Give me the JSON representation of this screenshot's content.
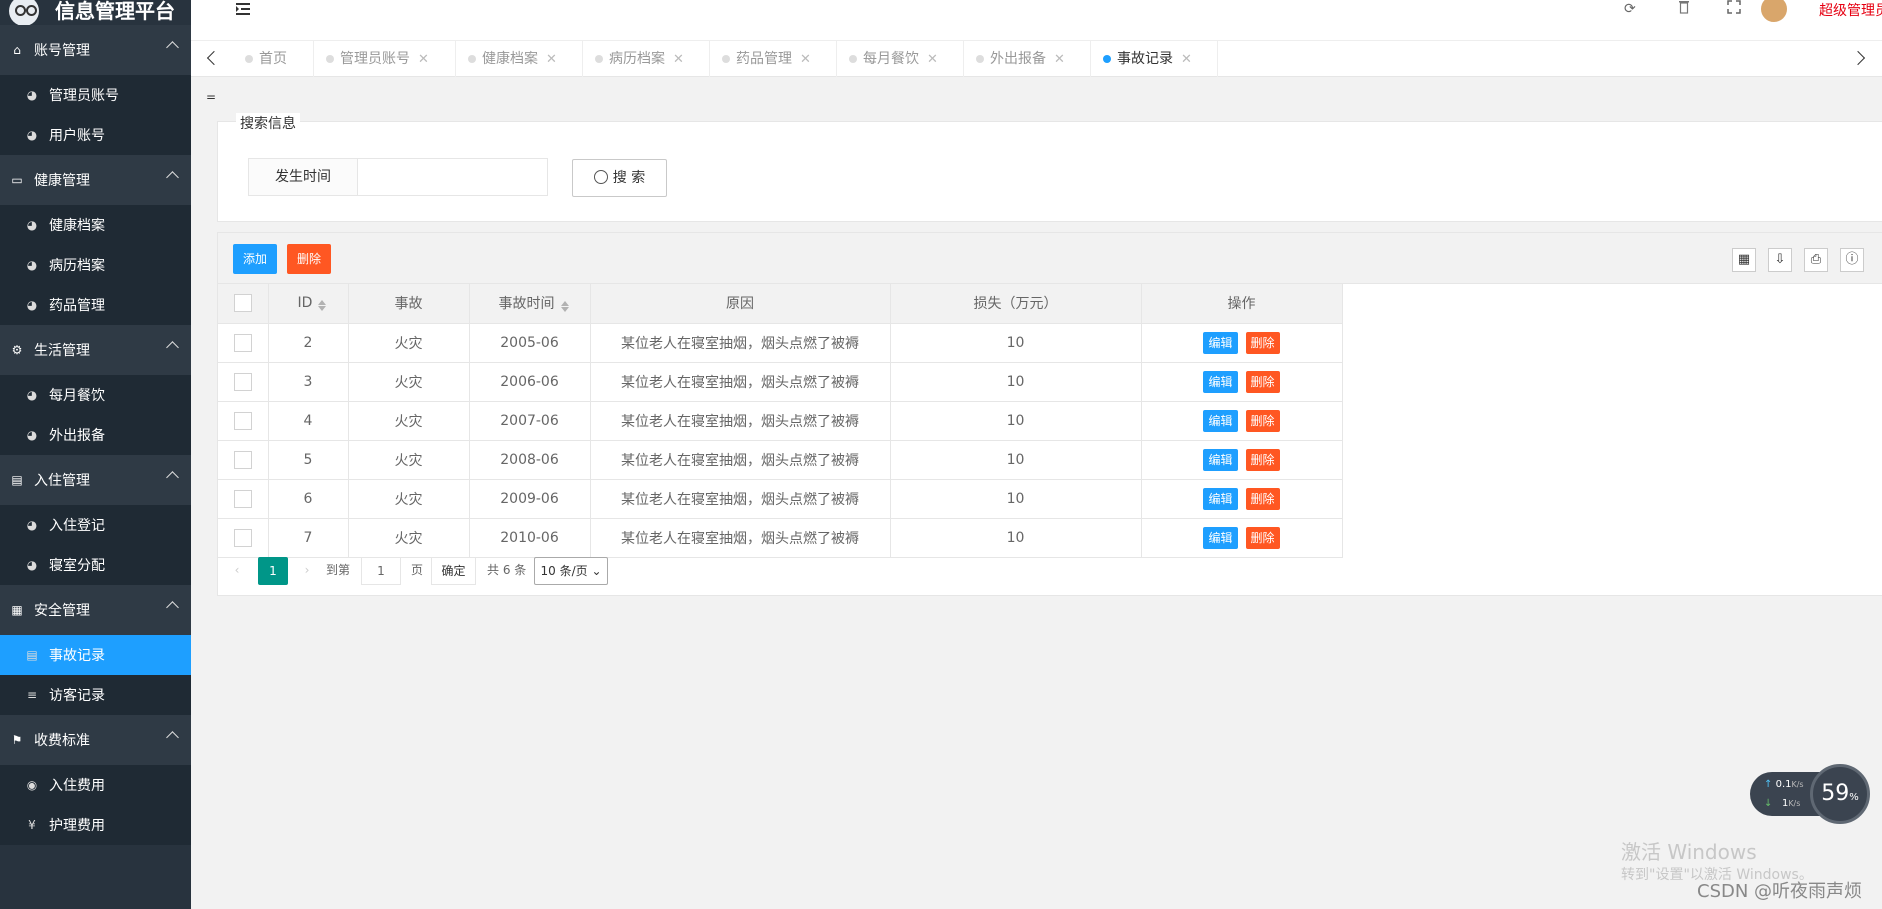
{
  "app": {
    "title": "信息管理平台",
    "user": "超级管理员"
  },
  "sidebar": {
    "groups": [
      {
        "label": "账号管理",
        "icon": "home-icon",
        "items": [
          {
            "label": "管理员账号",
            "icon": "dashboard-icon"
          },
          {
            "label": "用户账号",
            "icon": "dashboard-icon"
          }
        ]
      },
      {
        "label": "健康管理",
        "icon": "window-icon",
        "items": [
          {
            "label": "健康档案",
            "icon": "dashboard-icon"
          },
          {
            "label": "病历档案",
            "icon": "dashboard-icon"
          },
          {
            "label": "药品管理",
            "icon": "dashboard-icon"
          }
        ]
      },
      {
        "label": "生活管理",
        "icon": "cogs-icon",
        "items": [
          {
            "label": "每月餐饮",
            "icon": "dashboard-icon"
          },
          {
            "label": "外出报备",
            "icon": "dashboard-icon"
          }
        ]
      },
      {
        "label": "入住管理",
        "icon": "file-icon",
        "items": [
          {
            "label": "入住登记",
            "icon": "dashboard-icon"
          },
          {
            "label": "寝室分配",
            "icon": "dashboard-icon"
          }
        ]
      },
      {
        "label": "安全管理",
        "icon": "calendar-icon",
        "items": [
          {
            "label": "事故记录",
            "icon": "list-alt-icon",
            "active": true
          },
          {
            "label": "访客记录",
            "icon": "bars-icon"
          }
        ]
      },
      {
        "label": "收费标准",
        "icon": "flag-icon",
        "items": [
          {
            "label": "入住费用",
            "icon": "circle-icon"
          },
          {
            "label": "护理费用",
            "icon": "yen-icon"
          }
        ]
      }
    ]
  },
  "tabs": [
    {
      "label": "首页"
    },
    {
      "label": "管理员账号"
    },
    {
      "label": "健康档案"
    },
    {
      "label": "病历档案"
    },
    {
      "label": "药品管理"
    },
    {
      "label": "每月餐饮"
    },
    {
      "label": "外出报备"
    },
    {
      "label": "事故记录",
      "active": true
    }
  ],
  "tab_close": "✕",
  "breadcrumb_mark": "=",
  "search": {
    "legend": "搜索信息",
    "field_label": "发生时间",
    "value": "",
    "button": "搜 索"
  },
  "toolbar": {
    "add": "添加",
    "delete": "删除"
  },
  "table": {
    "columns": [
      "ID",
      "事故",
      "事故时间",
      "原因",
      "损失（万元）",
      "操作"
    ],
    "rows": [
      {
        "id": "2",
        "type": "火灾",
        "time": "2005-06",
        "reason": "某位老人在寝室抽烟，烟头点燃了被褥",
        "loss": "10"
      },
      {
        "id": "3",
        "type": "火灾",
        "time": "2006-06",
        "reason": "某位老人在寝室抽烟，烟头点燃了被褥",
        "loss": "10"
      },
      {
        "id": "4",
        "type": "火灾",
        "time": "2007-06",
        "reason": "某位老人在寝室抽烟，烟头点燃了被褥",
        "loss": "10"
      },
      {
        "id": "5",
        "type": "火灾",
        "time": "2008-06",
        "reason": "某位老人在寝室抽烟，烟头点燃了被褥",
        "loss": "10"
      },
      {
        "id": "6",
        "type": "火灾",
        "time": "2009-06",
        "reason": "某位老人在寝室抽烟，烟头点燃了被褥",
        "loss": "10"
      },
      {
        "id": "7",
        "type": "火灾",
        "time": "2010-06",
        "reason": "某位老人在寝室抽烟，烟头点燃了被褥",
        "loss": "10"
      }
    ],
    "edit": "编辑",
    "del": "删除"
  },
  "pager": {
    "current": "1",
    "goto": "到第",
    "goto_value": "1",
    "page": "页",
    "confirm": "确定",
    "total": "共 6 条",
    "size": "10 条/页"
  },
  "overlay": {
    "activate": "激活 Windows",
    "activate_hint": "转到\"设置\"以激活 Windows。",
    "csdn": "CSDN @听夜雨声烦",
    "up": "0.1",
    "down": "1",
    "unit": "K/s",
    "percent": "59",
    "pct_sign": "%"
  },
  "colors": {
    "sidebar": "#28333e",
    "accent": "#1e9fff",
    "danger": "#ff5722",
    "page": "#009688"
  }
}
